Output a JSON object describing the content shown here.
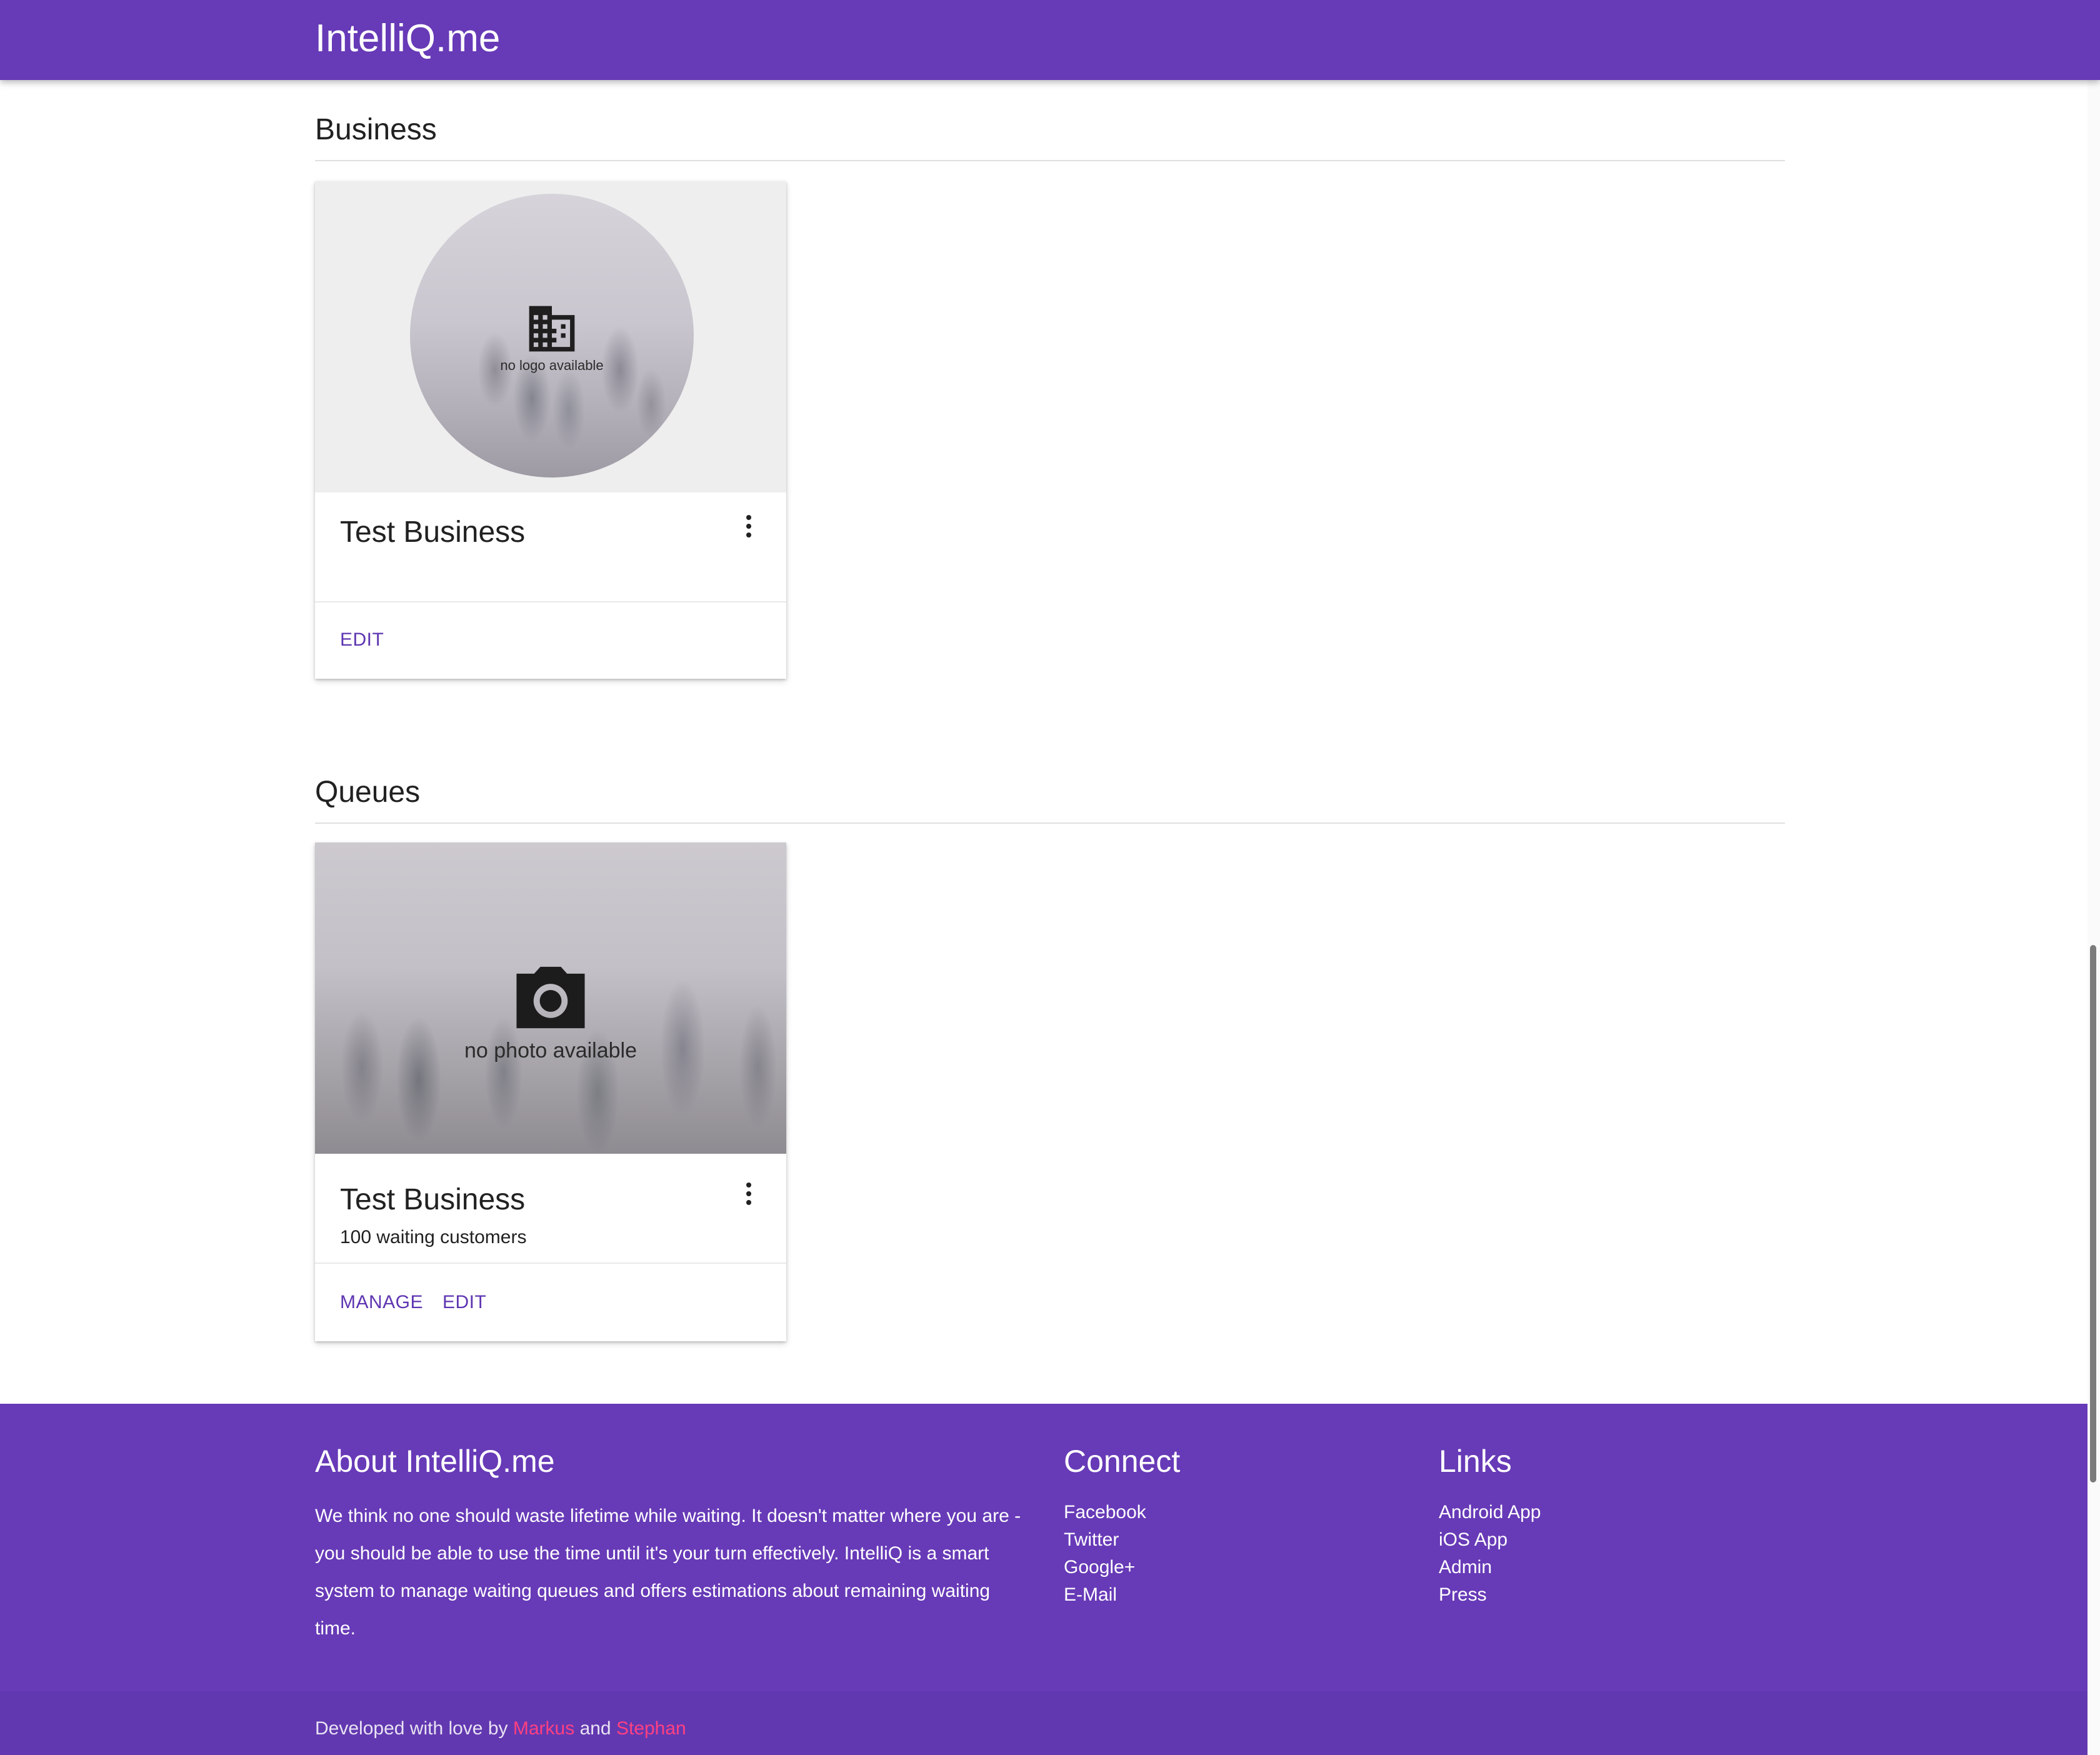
{
  "header": {
    "title": "IntelliQ.me"
  },
  "business_section": {
    "title": "Business",
    "card": {
      "placeholder_icon": "business-building-icon",
      "placeholder_text": "no logo available",
      "title": "Test Business",
      "more_icon": "more-vert-icon",
      "actions": {
        "edit": "EDIT"
      }
    }
  },
  "queues_section": {
    "title": "Queues",
    "card": {
      "placeholder_icon": "camera-icon",
      "placeholder_text": "no photo available",
      "title": "Test Business",
      "subtitle": "100 waiting customers",
      "more_icon": "more-vert-icon",
      "actions": {
        "manage": "MANAGE",
        "edit": "EDIT"
      }
    }
  },
  "footer": {
    "about": {
      "title": "About IntelliQ.me",
      "text": "We think no one should waste lifetime while waiting. It doesn't matter where you are - you should be able to use the time until it's your turn effectively. IntelliQ is a smart system to manage waiting queues and offers estimations about remaining waiting time."
    },
    "connect": {
      "title": "Connect",
      "links": [
        "Facebook",
        "Twitter",
        "Google+",
        "E-Mail"
      ]
    },
    "links": {
      "title": "Links",
      "links": [
        "Android App",
        "iOS App",
        "Admin",
        "Press"
      ]
    },
    "credit": {
      "prefix": "Developed with love by",
      "author1": "Markus",
      "joiner": "and",
      "author2": "Stephan"
    }
  },
  "colors": {
    "primary": "#673ab7",
    "action": "#5e35b1",
    "credit_accent": "#ff4081"
  }
}
